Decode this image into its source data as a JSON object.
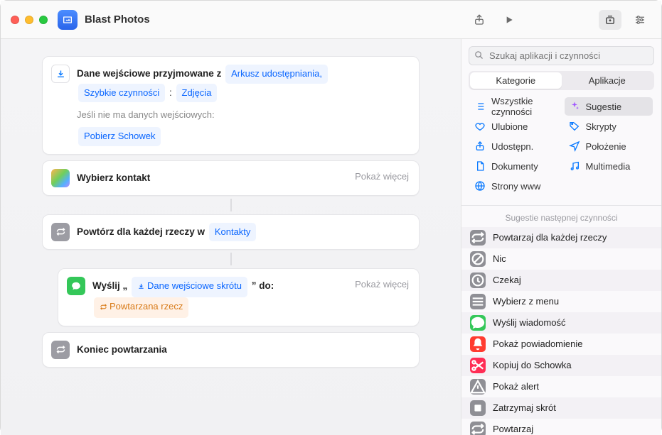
{
  "window": {
    "title": "Blast Photos"
  },
  "editor": {
    "input_card": {
      "label": "Dane wejściowe przyjmowane z",
      "tokens": [
        "Arkusz udostępniania,",
        "Szybkie czynności",
        "Zdjęcia"
      ],
      "token_sep": ":",
      "fallback_label": "Jeśli nie ma danych wejściowych:",
      "fallback_token": "Pobierz Schowek"
    },
    "select_contact": {
      "title": "Wybierz kontakt",
      "show_more": "Pokaż więcej"
    },
    "repeat": {
      "title_prefix": "Powtórz dla każdej rzeczy w",
      "token": "Kontakty"
    },
    "send": {
      "prefix": "Wyślij „",
      "input_token": "Dane wejściowe skrótu",
      "suffix": "” do:",
      "target_token": "Powtarzana rzecz",
      "show_more": "Pokaż więcej"
    },
    "end_repeat": {
      "title": "Koniec powtarzania"
    }
  },
  "sidebar": {
    "search_placeholder": "Szukaj aplikacji i czynności",
    "segments": {
      "left": "Kategorie",
      "right": "Aplikacje"
    },
    "categories": [
      {
        "label": "Wszystkie czynności",
        "icon": "list",
        "color": "ci-blue"
      },
      {
        "label": "Sugestie",
        "icon": "sparkle",
        "color": "ci-purple",
        "selected": true
      },
      {
        "label": "Ulubione",
        "icon": "heart",
        "color": "ci-blue"
      },
      {
        "label": "Skrypty",
        "icon": "tag",
        "color": "ci-blue"
      },
      {
        "label": "Udostępn.",
        "icon": "share",
        "color": "ci-blue"
      },
      {
        "label": "Położenie",
        "icon": "nav",
        "color": "ci-blue"
      },
      {
        "label": "Dokumenty",
        "icon": "doc",
        "color": "ci-blue"
      },
      {
        "label": "Multimedia",
        "icon": "music",
        "color": "ci-blue"
      },
      {
        "label": "Strony www",
        "icon": "globe",
        "color": "ci-blue"
      }
    ],
    "suggestions_title": "Sugestie następnej czynności",
    "suggestions": [
      {
        "label": "Powtarzaj dla każdej rzeczy",
        "icon": "repeat",
        "cls": "gray"
      },
      {
        "label": "Nic",
        "icon": "empty",
        "cls": "gray"
      },
      {
        "label": "Czekaj",
        "icon": "clock",
        "cls": "gray"
      },
      {
        "label": "Wybierz z menu",
        "icon": "menu",
        "cls": "gray"
      },
      {
        "label": "Wyślij wiadomość",
        "icon": "bubble",
        "cls": "green"
      },
      {
        "label": "Pokaż powiadomienie",
        "icon": "bell",
        "cls": "red"
      },
      {
        "label": "Kopiuj do Schowka",
        "icon": "scissor",
        "cls": "red2"
      },
      {
        "label": "Pokaż alert",
        "icon": "alert",
        "cls": "gray"
      },
      {
        "label": "Zatrzymaj skrót",
        "icon": "stop",
        "cls": "gray"
      },
      {
        "label": "Powtarzaj",
        "icon": "repeat",
        "cls": "gray"
      }
    ]
  }
}
